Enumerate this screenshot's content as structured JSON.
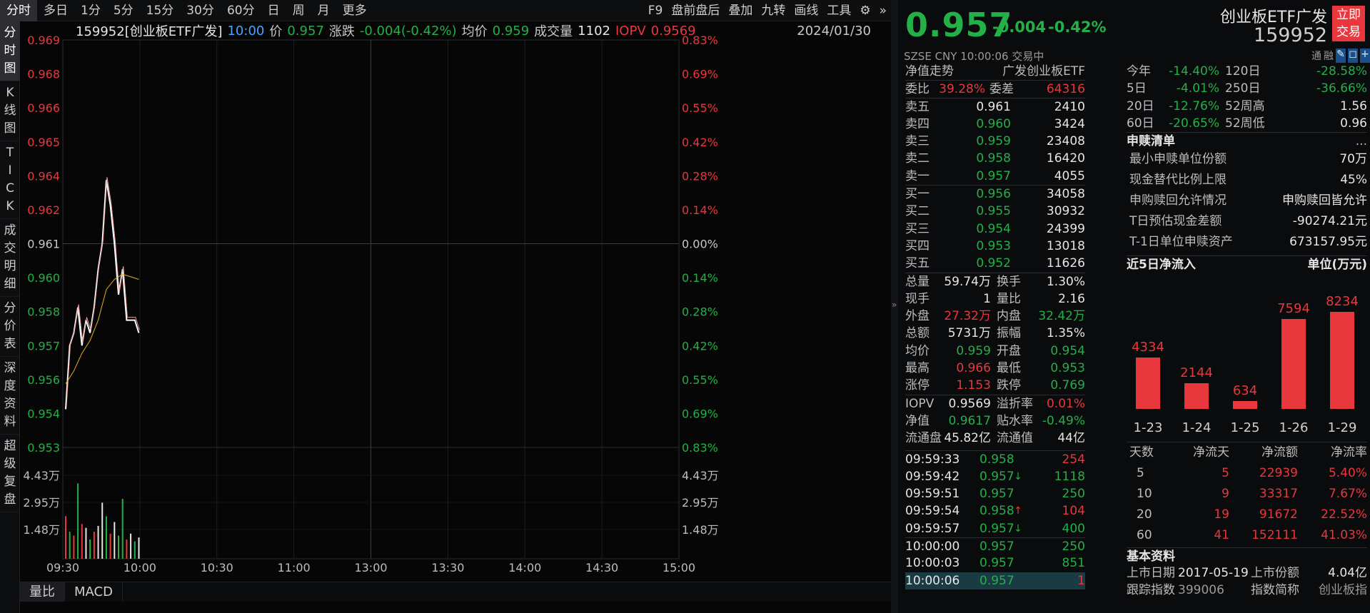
{
  "periodTabs": [
    "分时",
    "多日",
    "1分",
    "5分",
    "15分",
    "30分",
    "60分",
    "日",
    "周",
    "月",
    "更多"
  ],
  "toolTabs": [
    "F9",
    "盘前盘后",
    "叠加",
    "九转",
    "画线",
    "工具"
  ],
  "leftNav": [
    "分时图",
    "K线图",
    "TICK",
    "成交明细",
    "分价表",
    "深度资料",
    "超级复盘"
  ],
  "info": {
    "code": "159952[创业板ETF广发]",
    "time": "10:00",
    "priceLabel": "价",
    "price": "0.957",
    "chgLabel": "涨跌",
    "chg": "-0.004(-0.42%)",
    "avgLabel": "均价",
    "avg": "0.959",
    "volLabel": "成交量",
    "vol": "1102",
    "iopvLabel": "IOPV",
    "iopv": "0.9569",
    "date": "2024/01/30"
  },
  "yLeft": [
    "0.969",
    "0.968",
    "0.966",
    "0.965",
    "0.964",
    "0.962",
    "0.961",
    "0.960",
    "0.958",
    "0.957",
    "0.956",
    "0.954",
    "0.953"
  ],
  "yRight": [
    "0.83%",
    "0.69%",
    "0.55%",
    "0.42%",
    "0.28%",
    "0.14%",
    "0.00%",
    "0.14%",
    "0.28%",
    "0.42%",
    "0.55%",
    "0.69%",
    "0.83%"
  ],
  "volLeft": [
    "4.43万",
    "2.95万",
    "1.48万"
  ],
  "volRight": [
    "4.43万",
    "2.95万",
    "1.48万"
  ],
  "xTimes": [
    "09:30",
    "10:00",
    "10:30",
    "11:00",
    "13:00",
    "13:30",
    "14:00",
    "14:30",
    "15:00"
  ],
  "bottomTabs": [
    "量比",
    "MACD"
  ],
  "priceLine": [
    [
      0,
      0.9545
    ],
    [
      1,
      0.957
    ],
    [
      2,
      0.9575
    ],
    [
      3,
      0.9585
    ],
    [
      4,
      0.957
    ],
    [
      5,
      0.958
    ],
    [
      6,
      0.9575
    ],
    [
      7,
      0.9585
    ],
    [
      8,
      0.96
    ],
    [
      9,
      0.961
    ],
    [
      10,
      0.9635
    ],
    [
      11,
      0.9625
    ],
    [
      12,
      0.961
    ],
    [
      13,
      0.959
    ],
    [
      14,
      0.96
    ],
    [
      15,
      0.958
    ],
    [
      16,
      0.958
    ],
    [
      17,
      0.958
    ],
    [
      18,
      0.9575
    ]
  ],
  "avgLine": [
    [
      0,
      0.9555
    ],
    [
      2,
      0.956
    ],
    [
      4,
      0.9567
    ],
    [
      6,
      0.9572
    ],
    [
      8,
      0.958
    ],
    [
      10,
      0.9592
    ],
    [
      12,
      0.9596
    ],
    [
      14,
      0.9598
    ],
    [
      16,
      0.9597
    ],
    [
      18,
      0.9596
    ]
  ],
  "volBars": [
    {
      "v": 2.2,
      "c": "up"
    },
    {
      "v": 1.4,
      "c": "dn"
    },
    {
      "v": 1.2,
      "c": "up"
    },
    {
      "v": 3.9,
      "c": "dn"
    },
    {
      "v": 1.8,
      "c": "up"
    },
    {
      "v": 1.6,
      "c": "wt"
    },
    {
      "v": 1.0,
      "c": "dn"
    },
    {
      "v": 1.4,
      "c": "up"
    },
    {
      "v": 1.7,
      "c": "wt"
    },
    {
      "v": 2.9,
      "c": "wt"
    },
    {
      "v": 2.2,
      "c": "dn"
    },
    {
      "v": 1.3,
      "c": "up"
    },
    {
      "v": 1.9,
      "c": "wt"
    },
    {
      "v": 1.2,
      "c": "dn"
    },
    {
      "v": 3.1,
      "c": "dn"
    },
    {
      "v": 1.0,
      "c": "up"
    },
    {
      "v": 1.3,
      "c": "wt"
    },
    {
      "v": 0.9,
      "c": "dn"
    },
    {
      "v": 1.1,
      "c": "wt"
    }
  ],
  "quote": {
    "price": "0.957",
    "chg": "-0.004",
    "pct": "-0.42%",
    "name": "创业板ETF广发",
    "code": "159952",
    "tradeBtn": "立即交易",
    "exch": "SZSE  CNY  10:00:06  交易中",
    "icons": "通 融"
  },
  "navTitle": "净值走势",
  "navName": "广发创业板ETF",
  "weibi": {
    "l1": "委比",
    "v1": "39.28%",
    "l2": "委差",
    "v2": "64316"
  },
  "asks": [
    {
      "l": "卖五",
      "p": "0.961",
      "v": "2410",
      "c": "wt"
    },
    {
      "l": "卖四",
      "p": "0.960",
      "v": "3424",
      "c": "dn"
    },
    {
      "l": "卖三",
      "p": "0.959",
      "v": "23408",
      "c": "dn"
    },
    {
      "l": "卖二",
      "p": "0.958",
      "v": "16420",
      "c": "dn"
    },
    {
      "l": "卖一",
      "p": "0.957",
      "v": "4055",
      "c": "dn"
    }
  ],
  "bids": [
    {
      "l": "买一",
      "p": "0.956",
      "v": "34058",
      "c": "dn"
    },
    {
      "l": "买二",
      "p": "0.955",
      "v": "30932",
      "c": "dn"
    },
    {
      "l": "买三",
      "p": "0.954",
      "v": "24399",
      "c": "dn"
    },
    {
      "l": "买四",
      "p": "0.953",
      "v": "13018",
      "c": "dn"
    },
    {
      "l": "买五",
      "p": "0.952",
      "v": "11626",
      "c": "dn"
    }
  ],
  "stats": [
    {
      "l1": "总量",
      "v1": "59.74万",
      "c1": "wt",
      "l2": "换手",
      "v2": "1.30%",
      "c2": "wt"
    },
    {
      "l1": "现手",
      "v1": "1",
      "c1": "wt",
      "l2": "量比",
      "v2": "2.16",
      "c2": "wt"
    },
    {
      "l1": "外盘",
      "v1": "27.32万",
      "c1": "up",
      "l2": "内盘",
      "v2": "32.42万",
      "c2": "dn"
    },
    {
      "l1": "总额",
      "v1": "5731万",
      "c1": "wt",
      "l2": "振幅",
      "v2": "1.35%",
      "c2": "wt"
    },
    {
      "l1": "均价",
      "v1": "0.959",
      "c1": "dn",
      "l2": "开盘",
      "v2": "0.954",
      "c2": "dn"
    },
    {
      "l1": "最高",
      "v1": "0.966",
      "c1": "up",
      "l2": "最低",
      "v2": "0.953",
      "c2": "dn"
    },
    {
      "l1": "涨停",
      "v1": "1.153",
      "c1": "up",
      "l2": "跌停",
      "v2": "0.769",
      "c2": "dn"
    }
  ],
  "stats2": [
    {
      "l1": "IOPV",
      "v1": "0.9569",
      "c1": "wt",
      "l2": "溢折率",
      "v2": "0.01%",
      "c2": "up"
    },
    {
      "l1": "净值",
      "v1": "0.9617",
      "c1": "dn",
      "l2": "贴水率",
      "v2": "-0.49%",
      "c2": "dn"
    },
    {
      "l1": "流通盘",
      "v1": "45.82亿",
      "c1": "wt",
      "l2": "流通值",
      "v2": "44亿",
      "c2": "wt"
    }
  ],
  "ticks": [
    {
      "t": "09:59:33",
      "p": "0.958",
      "a": "",
      "v": "254",
      "vc": "up"
    },
    {
      "t": "09:59:42",
      "p": "0.957",
      "a": "↓",
      "v": "1118",
      "vc": "dn"
    },
    {
      "t": "09:59:51",
      "p": "0.957",
      "a": "",
      "v": "250",
      "vc": "dn"
    },
    {
      "t": "09:59:54",
      "p": "0.958",
      "a": "↑",
      "v": "104",
      "vc": "up"
    },
    {
      "t": "09:59:57",
      "p": "0.957",
      "a": "↓",
      "v": "400",
      "vc": "dn"
    },
    {
      "t": "10:00:00",
      "p": "0.957",
      "a": "",
      "v": "250",
      "vc": "dn"
    },
    {
      "t": "10:00:03",
      "p": "0.957",
      "a": "",
      "v": "851",
      "vc": "dn"
    },
    {
      "t": "10:00:06",
      "p": "0.957",
      "a": "",
      "v": "1",
      "vc": "up"
    }
  ],
  "perf": [
    {
      "l1": "今年",
      "v1": "-14.40%",
      "l2": "120日",
      "v2": "-28.58%"
    },
    {
      "l1": "5日",
      "v1": "-4.01%",
      "l2": "250日",
      "v2": "-36.66%"
    },
    {
      "l1": "20日",
      "v1": "-12.76%",
      "l2": "52周高",
      "v2": "1.56"
    },
    {
      "l1": "60日",
      "v1": "-20.65%",
      "l2": "52周低",
      "v2": "0.96"
    }
  ],
  "sg": {
    "title": "申赎清单",
    "more": "...",
    "rows": [
      [
        "最小申赎单位份额",
        "70万"
      ],
      [
        "现金替代比例上限",
        "45%"
      ],
      [
        "申购赎回允许情况",
        "申购赎回皆允许"
      ],
      [
        "T日预估现金差额",
        "-90274.21元"
      ],
      [
        "T-1日单位申赎资产",
        "673157.95元"
      ]
    ]
  },
  "flow": {
    "title": "近5日净流入",
    "unit": "单位(万元)",
    "days": [
      "1-23",
      "1-24",
      "1-25",
      "1-26",
      "1-29"
    ],
    "values": [
      4334,
      2144,
      634,
      7594,
      8234
    ]
  },
  "flowTable": {
    "headers": [
      "天数",
      "净流天",
      "净流额",
      "净流率"
    ],
    "rows": [
      [
        "5",
        "5",
        "22939",
        "5.40%"
      ],
      [
        "10",
        "9",
        "33317",
        "7.67%"
      ],
      [
        "20",
        "19",
        "91672",
        "22.52%"
      ],
      [
        "60",
        "41",
        "152111",
        "41.03%"
      ]
    ]
  },
  "basic": {
    "title": "基本资料",
    "l1": "上市日期",
    "v1": "2017-05-19",
    "l2": "上市份额",
    "v2": "4.04亿",
    "l3": "跟踪指数",
    "v3": "399006",
    "l4": "指数简称",
    "v4": "创业板指"
  }
}
